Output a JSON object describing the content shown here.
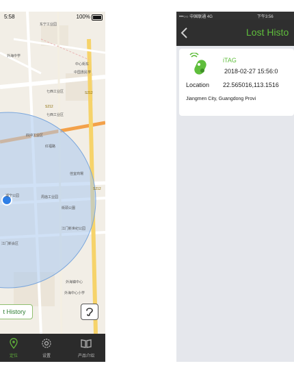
{
  "left_phone": {
    "status": {
      "time": "5:58",
      "battery": "100%"
    },
    "lost_history_button": "t History",
    "tabs": [
      {
        "label": "定位",
        "icon": "location-pin-icon",
        "active": true
      },
      {
        "label": "设置",
        "icon": "gear-icon",
        "active": false
      },
      {
        "label": "产品介绍",
        "icon": "book-icon",
        "active": false
      }
    ],
    "map_labels": {
      "l1": "东宁工业园",
      "l2": "中心街东",
      "l3": "外海中学",
      "l4": "中国惠民学",
      "l5": "七西工业区",
      "l6": "七西工业区",
      "l7": "S212",
      "l8": "四沖工业区",
      "l9": "S212",
      "l10": "红福路",
      "l11": "佳宜商場",
      "l12": "S212",
      "l13": "潮宁公园",
      "l14": "周庙工业园",
      "l15": "街頭公園",
      "l16": "江门新世纪公园",
      "l17": "江门新会区",
      "l18": "外海中心小学",
      "l19": "外海镇中心"
    }
  },
  "right_phone": {
    "status": {
      "carrier": "•••○○ 中国联通 4G",
      "time": "下午3:56"
    },
    "nav_title": "Lost Histo",
    "record": {
      "name": "iTAG",
      "datetime": "2018-02-27 15:56:0",
      "location_label": "Location",
      "coords": "22.565016,113.1516",
      "address": "Jiangmen City, Guangdong Provi"
    }
  },
  "colors": {
    "accent_green": "#5fbe3c",
    "tabbar_bg": "#2b2b2b",
    "navbar_bg": "#2f2f2f",
    "map_circle": "#a9c9ee",
    "location_dot": "#2f7fe6"
  }
}
